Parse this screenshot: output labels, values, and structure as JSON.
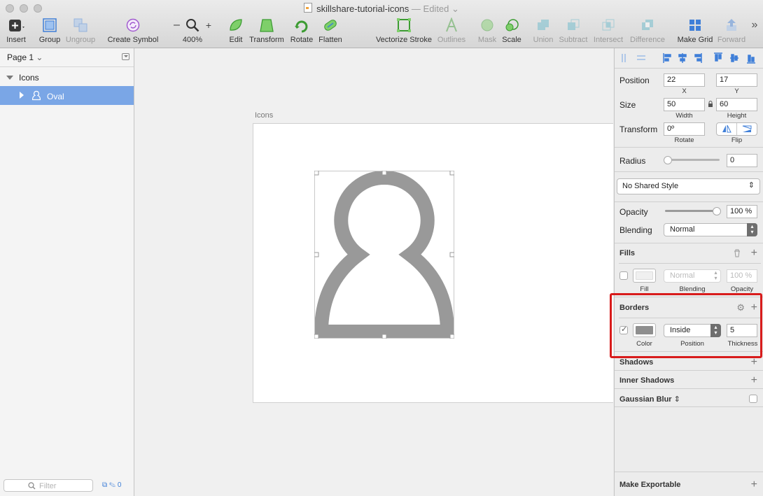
{
  "window": {
    "title": "skillshare-tutorial-icons",
    "edited": "— Edited"
  },
  "toolbar": {
    "insert": "Insert",
    "group": "Group",
    "ungroup": "Ungroup",
    "create_symbol": "Create Symbol",
    "zoom": "400%",
    "zoom_minus": "–",
    "zoom_plus": "+",
    "edit": "Edit",
    "transform": "Transform",
    "rotate": "Rotate",
    "flatten": "Flatten",
    "vectorize_stroke": "Vectorize Stroke",
    "outlines": "Outlines",
    "mask": "Mask",
    "scale": "Scale",
    "union": "Union",
    "subtract": "Subtract",
    "intersect": "Intersect",
    "difference": "Difference",
    "make_grid": "Make Grid",
    "forward": "Forward",
    "more": "»"
  },
  "sidebar": {
    "page": "Page 1",
    "layers": [
      {
        "name": "Icons"
      },
      {
        "name": "Oval"
      }
    ],
    "filter_placeholder": "Filter",
    "filter_count": "0"
  },
  "canvas": {
    "artboard_title": "Icons",
    "shape_color": "#999999"
  },
  "inspector": {
    "position_label": "Position",
    "x": "22",
    "y": "17",
    "x_label": "X",
    "y_label": "Y",
    "size_label": "Size",
    "width": "50",
    "height": "60",
    "width_label": "Width",
    "height_label": "Height",
    "transform_label": "Transform",
    "rotate": "0º",
    "rotate_label": "Rotate",
    "flip_label": "Flip",
    "radius_label": "Radius",
    "radius": "0",
    "shared_style": "No Shared Style",
    "opacity_label": "Opacity",
    "opacity": "100 %",
    "blending_label": "Blending",
    "blending": "Normal",
    "fills": {
      "title": "Fills",
      "blend": "Normal",
      "opacity": "100 %",
      "fill_label": "Fill",
      "blending_label": "Blending",
      "opacity_label": "Opacity"
    },
    "borders": {
      "title": "Borders",
      "position": "Inside",
      "thickness": "5",
      "color": "#8e8e8e",
      "color_label": "Color",
      "position_label": "Position",
      "thickness_label": "Thickness"
    },
    "shadows": "Shadows",
    "inner_shadows": "Inner Shadows",
    "gaussian_blur": "Gaussian Blur",
    "make_exportable": "Make Exportable"
  }
}
